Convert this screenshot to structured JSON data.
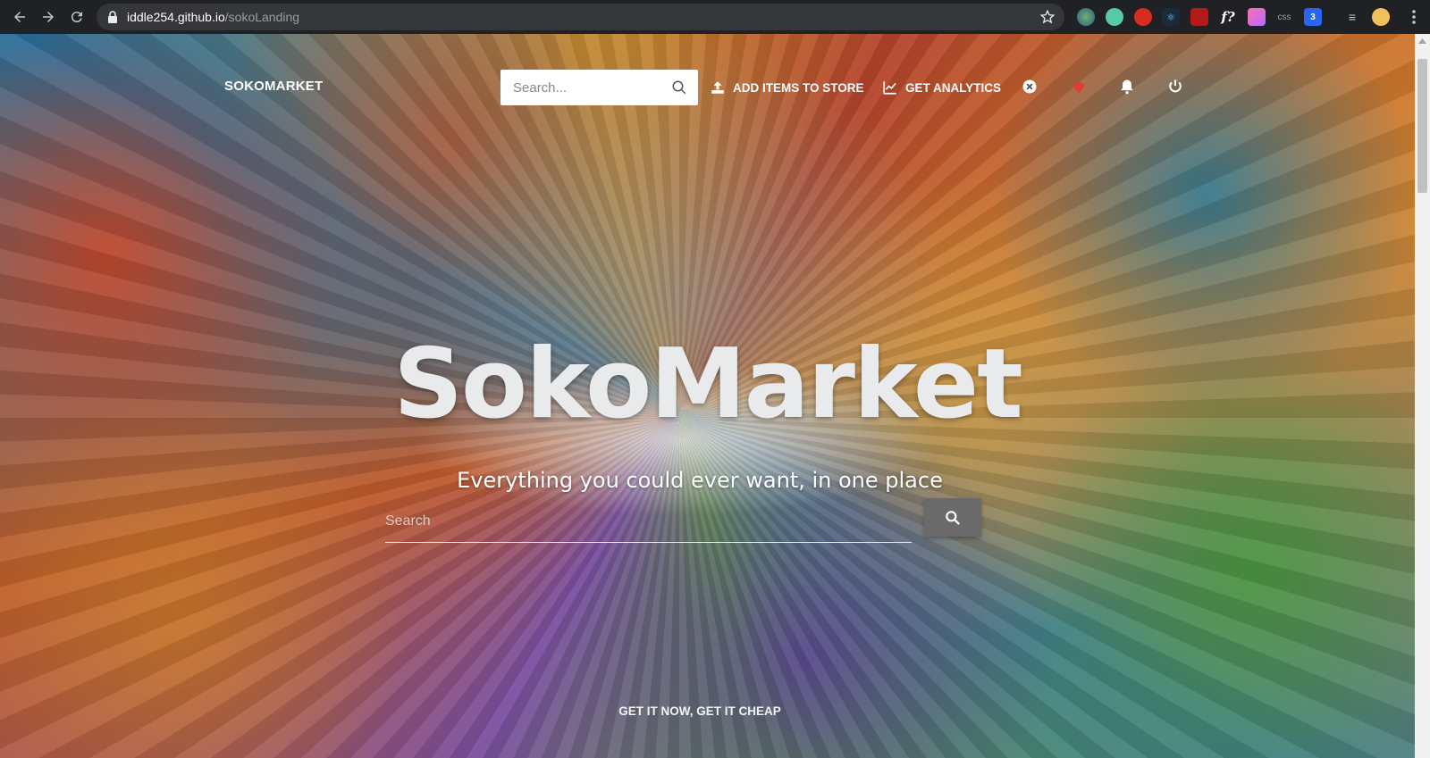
{
  "browser": {
    "url_host": "iddle254.github.io",
    "url_path": "/sokoLanding",
    "extensions": [
      "ext-globe",
      "ext-green",
      "ext-opera",
      "ext-react",
      "ext-ruby",
      "f?",
      "ext-pink",
      "css",
      "ext-css3",
      "ext-playlist",
      "ext-avatar"
    ]
  },
  "navbar": {
    "brand": "SOKOMARKET",
    "search_placeholder": "Search...",
    "add_items_label": "ADD ITEMS TO STORE",
    "analytics_label": "GET ANALYTICS"
  },
  "hero": {
    "title": "SokoMarket",
    "subtitle": "Everything you could ever want, in one place",
    "search_placeholder": "Search",
    "tagline": "GET IT NOW, GET IT CHEAP"
  },
  "colors": {
    "heart": "#e53935",
    "search_button": "#6a6a6a"
  }
}
